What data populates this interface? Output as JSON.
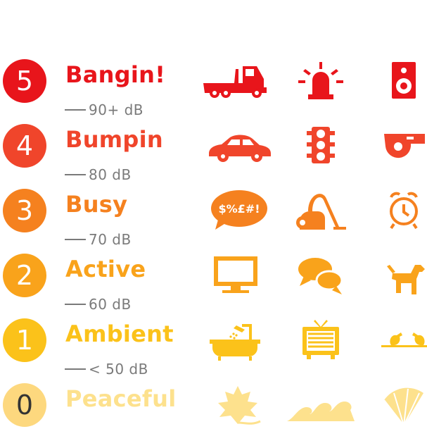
{
  "levels": [
    {
      "number": "5",
      "name": "Bangin!",
      "db": "90+ dB",
      "color": "#e8151b",
      "icons": [
        "truck-icon",
        "siren-icon",
        "speaker-icon"
      ]
    },
    {
      "number": "4",
      "name": "Bumpin",
      "db": "80 dB",
      "color": "#f0452b",
      "icons": [
        "car-icon",
        "traffic-light-icon",
        "whistle-icon"
      ]
    },
    {
      "number": "3",
      "name": "Busy",
      "db": "70 dB",
      "color": "#f5811f",
      "icons": [
        "swearing-bubble-icon",
        "vacuum-cleaner-icon",
        "alarm-clock-icon"
      ],
      "bubble_text": "$%£#!"
    },
    {
      "number": "2",
      "name": "Active",
      "db": "60 dB",
      "color": "#f9a31b",
      "icons": [
        "monitor-icon",
        "chat-bubbles-icon",
        "dog-icon"
      ]
    },
    {
      "number": "1",
      "name": "Ambient",
      "db": "< 50 dB",
      "color": "#fbc21a",
      "icons": [
        "shower-bathtub-icon",
        "television-icon",
        "birds-on-wire-icon"
      ]
    },
    {
      "number": "0",
      "name": "Peaceful",
      "db": "",
      "color": "#fde18d",
      "circle_color": "#fdd87e",
      "number_color": "#333333",
      "icons": [
        "leaf-icon",
        "waves-icon",
        "fan-icon"
      ]
    }
  ]
}
